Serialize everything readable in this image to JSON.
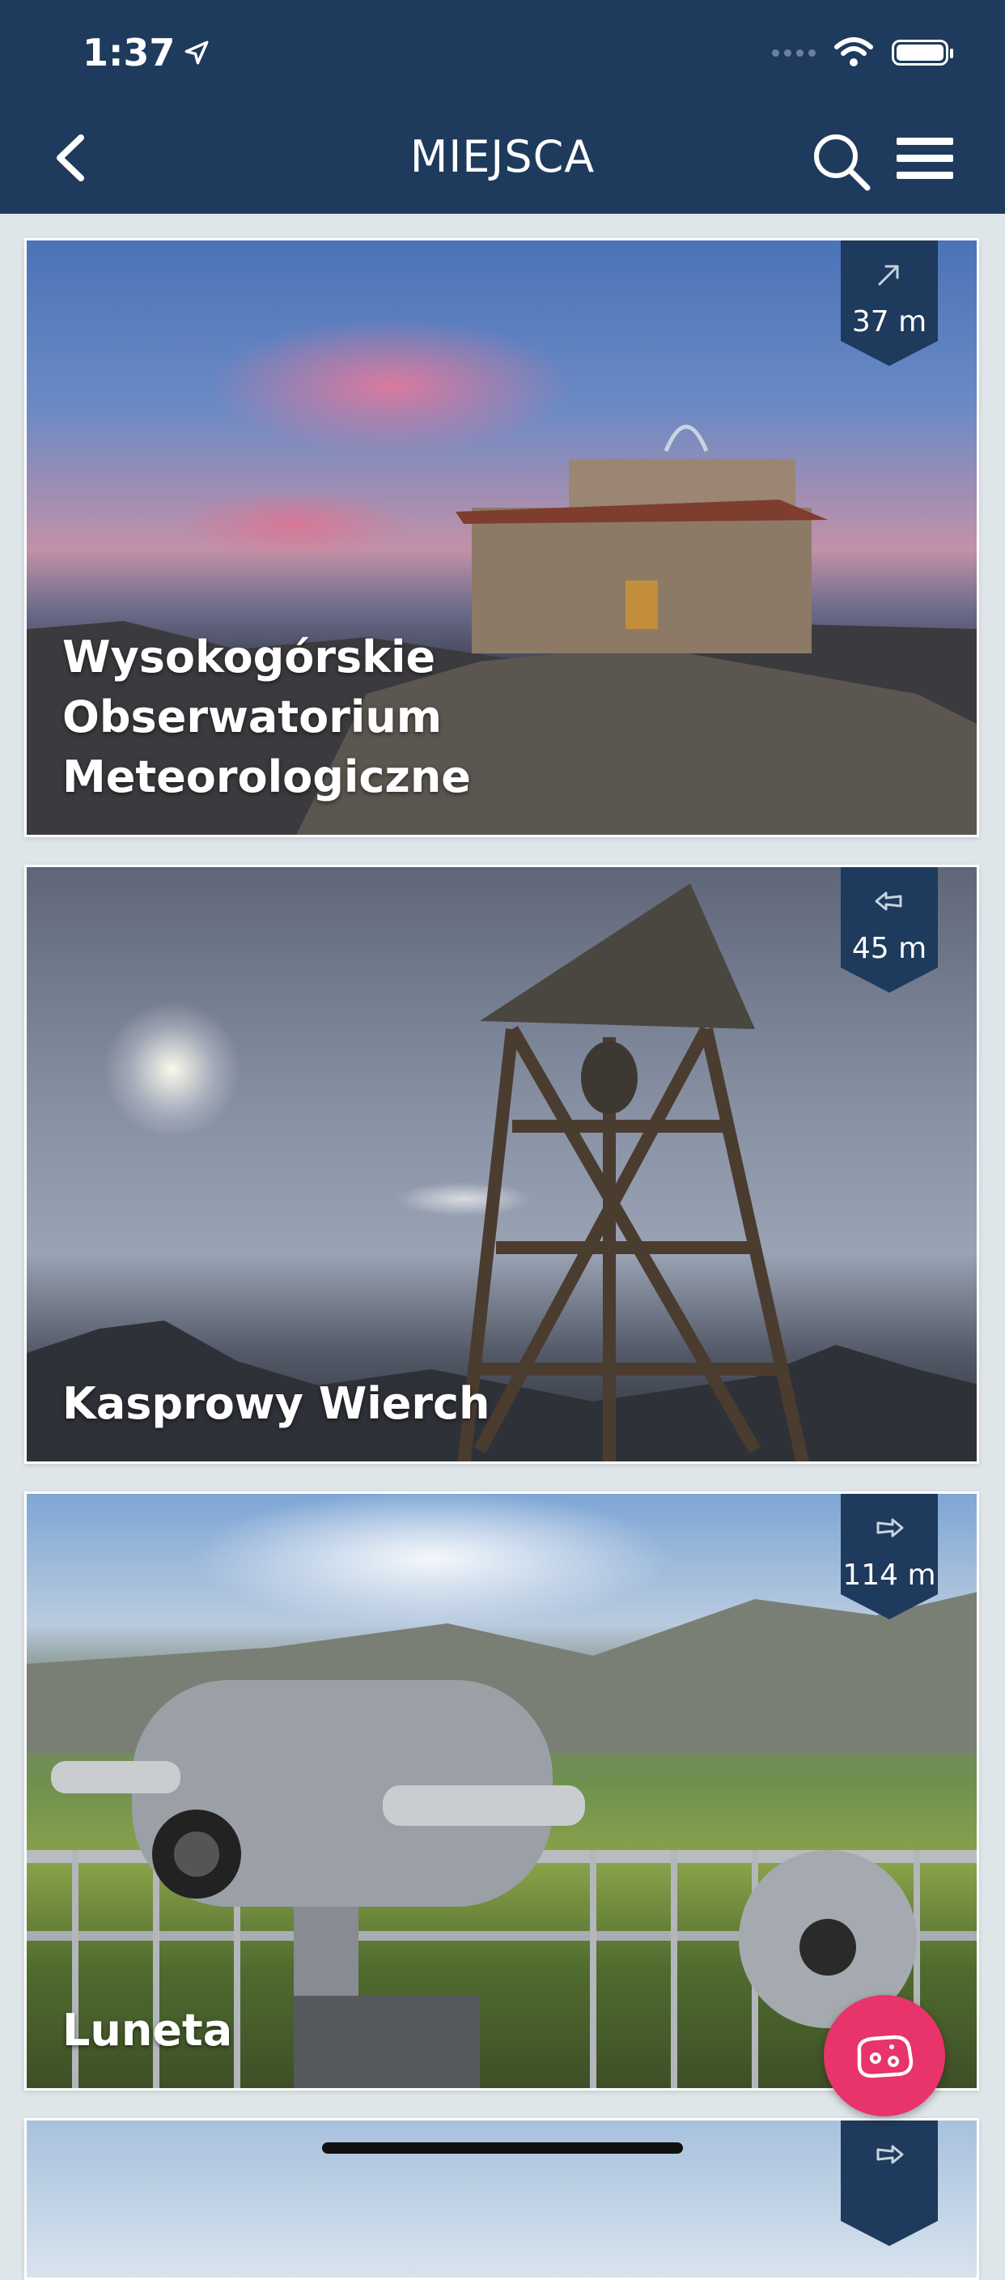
{
  "status_bar": {
    "time": "1:37"
  },
  "header": {
    "title": "MIEJSCA"
  },
  "places": [
    {
      "name": "Wysokogórskie Obserwatorium Meteorologiczne",
      "distance": "37 m",
      "direction_icon": "arrow-up-right-icon"
    },
    {
      "name": "Kasprowy Wierch",
      "distance": "45 m",
      "direction_icon": "arrow-left-icon"
    },
    {
      "name": "Luneta",
      "distance": "114 m",
      "direction_icon": "arrow-right-icon"
    }
  ],
  "colors": {
    "header_bg": "#1e3a5c",
    "fab_bg": "#e8336b",
    "page_bg": "#dfe6ea"
  }
}
